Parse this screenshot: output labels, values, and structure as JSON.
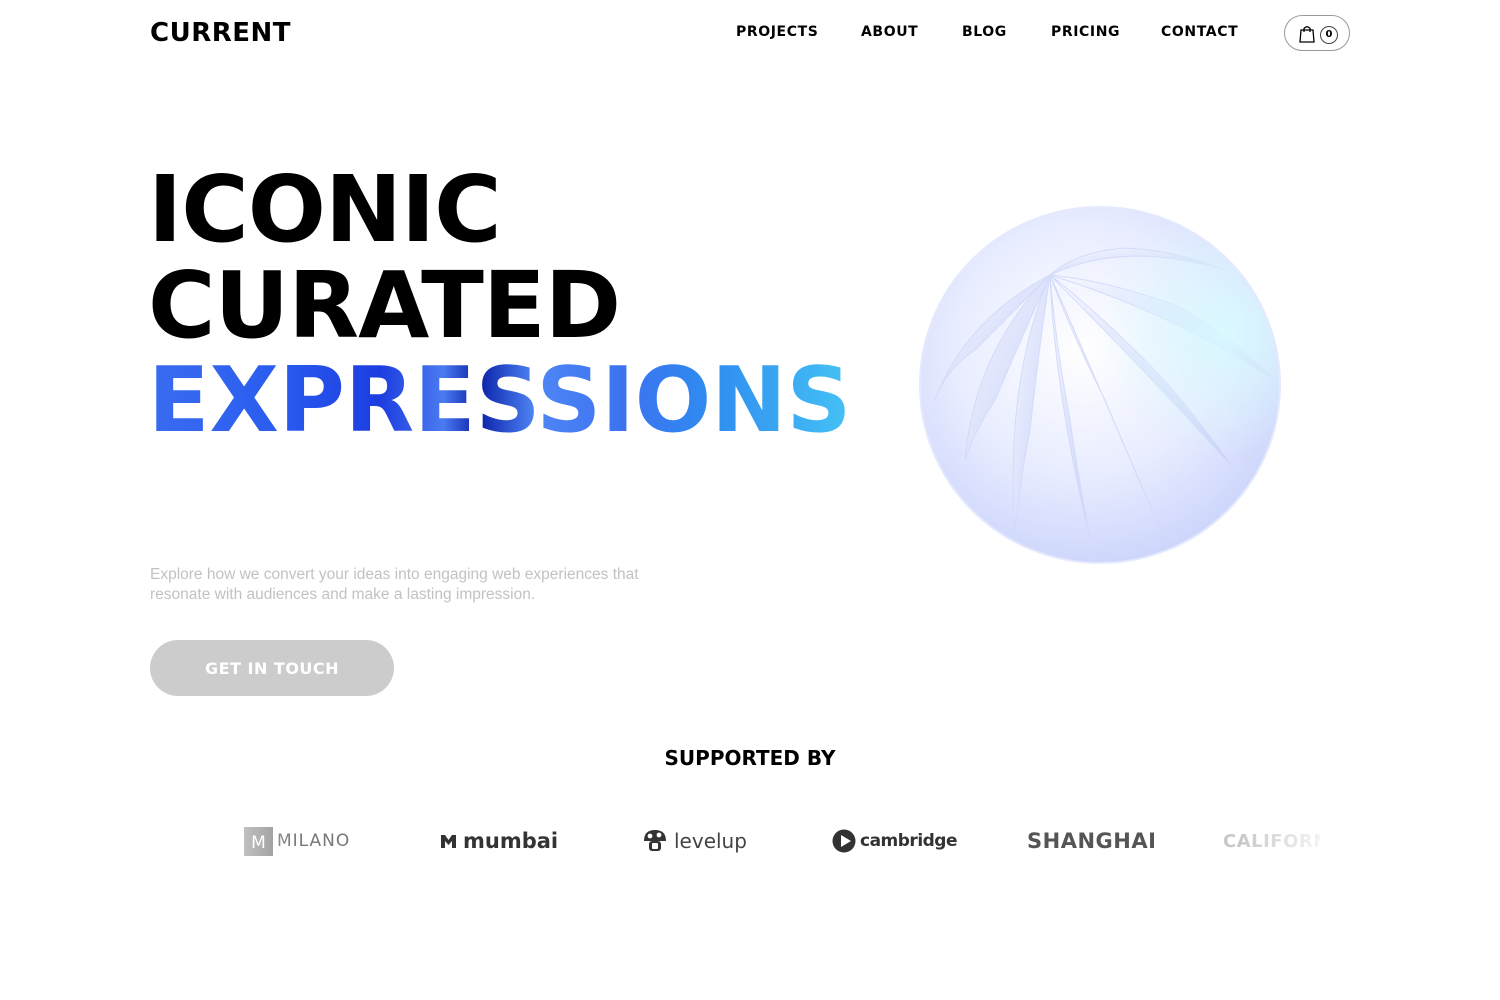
{
  "header": {
    "logo": "CURRENT",
    "nav": [
      {
        "label": "PROJECTS"
      },
      {
        "label": "ABOUT"
      },
      {
        "label": "BLOG"
      },
      {
        "label": "PRICING"
      },
      {
        "label": "CONTACT"
      }
    ],
    "cart_count": "0"
  },
  "hero": {
    "line1": "ICONIC",
    "line2": "CURATED",
    "line3": "EXPRESSIONS",
    "description": "Explore how we convert your ideas into engaging web experiences that resonate with audiences and make a lasting impression.",
    "cta_label": "GET IN TOUCH"
  },
  "supported": {
    "title": "SUPPORTED BY",
    "brands": [
      {
        "name": "MILANO",
        "icon": "m-square-icon"
      },
      {
        "name": "mumbai",
        "icon": "m-mark-icon"
      },
      {
        "name": "levelup",
        "icon": "mushroom-icon"
      },
      {
        "name": "cambridge",
        "icon": "play-circle-icon"
      },
      {
        "name": "SHANGHAI",
        "icon": "none"
      },
      {
        "name": "CALIFORN",
        "icon": "none"
      }
    ]
  },
  "colors": {
    "accent_gradient_start": "#3a6cf0",
    "accent_gradient_end": "#45c3f5",
    "cta_background": "#cccccc"
  }
}
